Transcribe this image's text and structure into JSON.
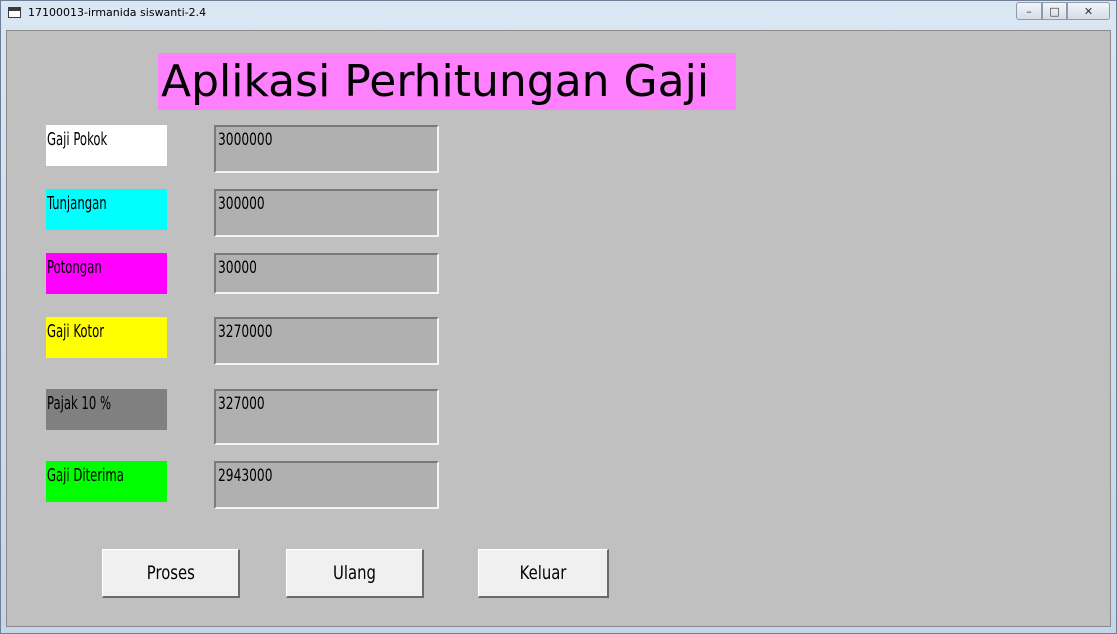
{
  "window": {
    "title": "17100013-irmanida siswanti-2.4",
    "minimize_glyph": "–",
    "maximize_glyph": "□",
    "close_glyph": "✕"
  },
  "form": {
    "heading": "Aplikasi Perhitungan Gaji",
    "rows": [
      {
        "label": "Gaji Pokok",
        "value": "3000000",
        "label_color": "#ffffff"
      },
      {
        "label": "Tunjangan",
        "value": "300000",
        "label_color": "#00ffff"
      },
      {
        "label": "Potongan",
        "value": "30000",
        "label_color": "#ff00ff"
      },
      {
        "label": "Gaji Kotor",
        "value": "3270000",
        "label_color": "#ffff00"
      },
      {
        "label": "Pajak 10 %",
        "value": "327000",
        "label_color": "#808080"
      },
      {
        "label": "Gaji Diterima",
        "value": "2943000",
        "label_color": "#00ff00"
      }
    ],
    "buttons": {
      "proses": "Proses",
      "ulang": "Ulang",
      "keluar": "Keluar"
    }
  },
  "colors": {
    "heading_bg": "#ff80ff",
    "form_bg": "#c0c0c0",
    "field_bg": "#b0b0b0"
  }
}
